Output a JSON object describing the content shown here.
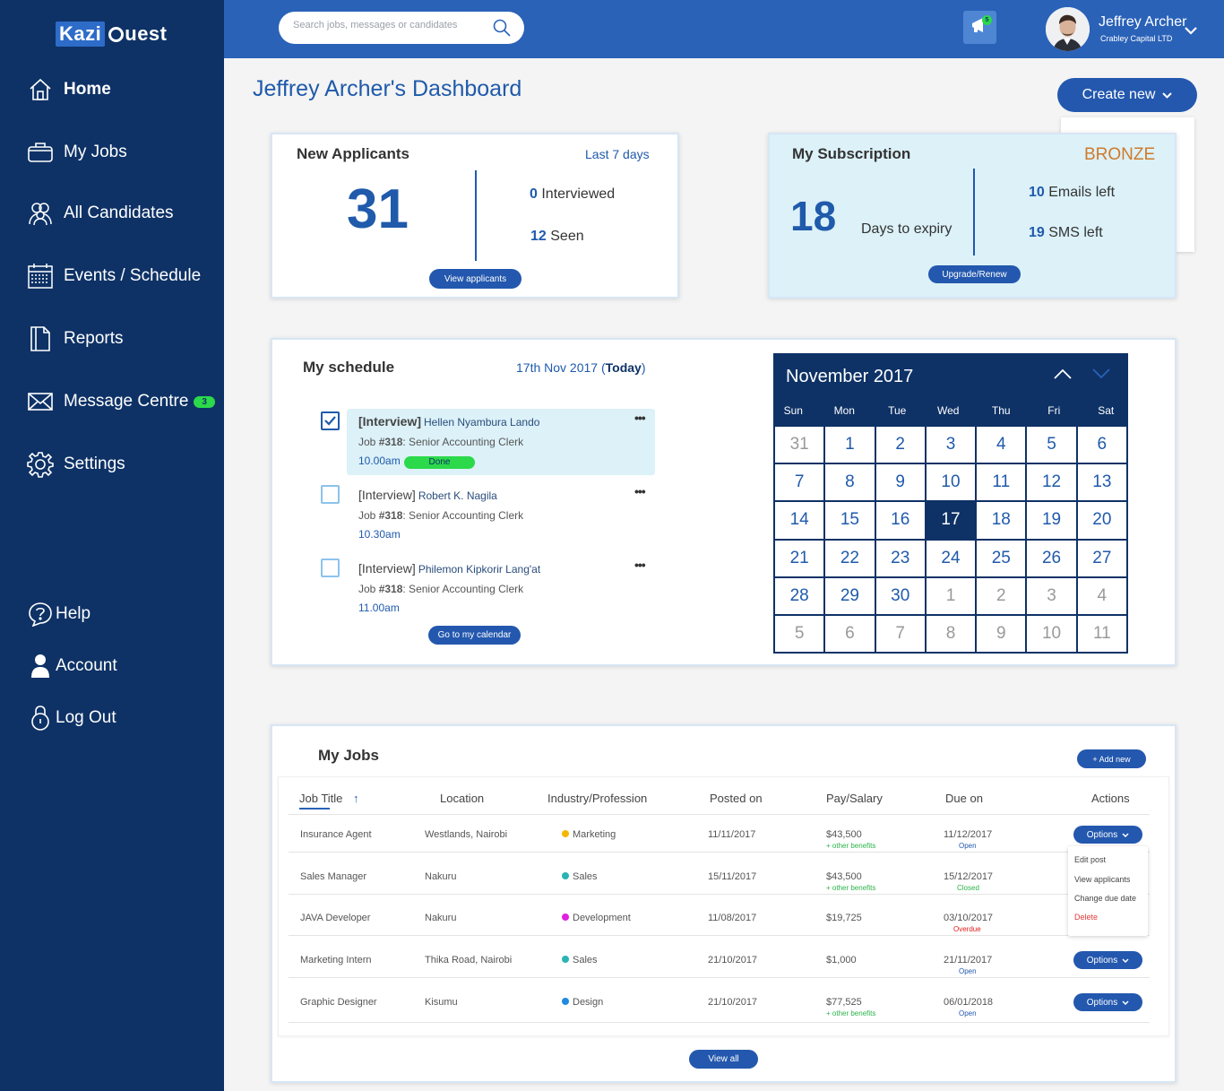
{
  "app": {
    "logo_part1": "Kazi",
    "logo_part2": "uest"
  },
  "sidebar": {
    "items": [
      {
        "label": "Home"
      },
      {
        "label": "My Jobs"
      },
      {
        "label": "All Candidates"
      },
      {
        "label": "Events / Schedule"
      },
      {
        "label": "Reports"
      },
      {
        "label": "Message Centre",
        "badge": "3"
      },
      {
        "label": "Settings"
      }
    ],
    "bottom": [
      {
        "label": "Help"
      },
      {
        "label": "Account"
      },
      {
        "label": "Log Out"
      }
    ]
  },
  "topbar": {
    "search_placeholder": "Search jobs, messages or candidates",
    "notification_count": "5",
    "user_name": "Jeffrey Archer",
    "user_company": "Crabley Capital LTD"
  },
  "page": {
    "title": "Jeffrey Archer's Dashboard",
    "create_label": "Create new"
  },
  "applicants": {
    "title": "New Applicants",
    "period": "Last 7 days",
    "count": "31",
    "interviewed_num": "0",
    "interviewed_label": "Interviewed",
    "seen_num": "12",
    "seen_label": "Seen",
    "button": "View applicants"
  },
  "subscription": {
    "title": "My Subscription",
    "tier": "BRONZE",
    "days": "18",
    "days_label": "Days to expiry",
    "emails_num": "10",
    "emails_label": "Emails left",
    "sms_num": "19",
    "sms_label": "SMS left",
    "button": "Upgrade/Renew"
  },
  "schedule": {
    "title": "My schedule",
    "date": "17th Nov 2017 (",
    "today": "Today",
    "date_close": ")",
    "items": [
      {
        "type": "[Interview]",
        "name": "Hellen Nyambura Lando",
        "job_prefix": "Job ",
        "job_num": "#318",
        "job_title": ": Senior Accounting Clerk",
        "time": "10.00am",
        "status": "Done",
        "checked": true
      },
      {
        "type": "[Interview]",
        "name": "Robert K. Nagila",
        "job_prefix": "Job ",
        "job_num": "#318",
        "job_title": ": Senior Accounting Clerk",
        "time": "10.30am",
        "checked": false
      },
      {
        "type": "[Interview]",
        "name": "Philemon Kipkorir Lang'at",
        "job_prefix": "Job ",
        "job_num": "#318",
        "job_title": ": Senior Accounting Clerk",
        "time": "11.00am",
        "checked": false
      }
    ],
    "button": "Go to my calendar"
  },
  "calendar": {
    "month": "November 2017",
    "weekdays": [
      "Sun",
      "Mon",
      "Tue",
      "Wed",
      "Thu",
      "Fri",
      "Sat"
    ],
    "days": [
      "31",
      "1",
      "2",
      "3",
      "4",
      "5",
      "6",
      "7",
      "8",
      "9",
      "10",
      "11",
      "12",
      "13",
      "14",
      "15",
      "16",
      "17",
      "18",
      "19",
      "20",
      "21",
      "22",
      "23",
      "24",
      "25",
      "26",
      "27",
      "28",
      "29",
      "30",
      "1",
      "2",
      "3",
      "4",
      "5",
      "6",
      "7",
      "8",
      "9",
      "10",
      "11"
    ],
    "current_month_start": 1,
    "current_month_end": 30,
    "today_index": 17
  },
  "jobs": {
    "title": "My Jobs",
    "add_label": "+ Add new",
    "headers": [
      "Job Title",
      "Location",
      "Industry/Profession",
      "Posted on",
      "Pay/Salary",
      "Due on",
      "Actions"
    ],
    "rows": [
      {
        "title": "Insurance Agent",
        "location": "Westlands, Nairobi",
        "industry": "Marketing",
        "industry_color": "#f5b800",
        "posted": "11/11/2017",
        "pay": "$43,500",
        "pay_note": "+ other benefits",
        "due": "11/12/2017",
        "due_status": "Open",
        "due_color": "#2358ae",
        "action": "Options"
      },
      {
        "title": "Sales Manager",
        "location": "Nakuru",
        "industry": "Sales",
        "industry_color": "#2bb3b3",
        "posted": "15/11/2017",
        "pay": "$43,500",
        "pay_note": "+ other benefits",
        "due": "15/12/2017",
        "due_status": "Closed",
        "due_color": "#2bb34a",
        "action": ""
      },
      {
        "title": "JAVA Developer",
        "location": "Nakuru",
        "industry": "Development",
        "industry_color": "#e020e0",
        "posted": "11/08/2017",
        "pay": "$19,725",
        "pay_note": "",
        "due": "03/10/2017",
        "due_status": "Overdue",
        "due_color": "#e02020",
        "action": ""
      },
      {
        "title": "Marketing Intern",
        "location": "Thika Road, Nairobi",
        "industry": "Sales",
        "industry_color": "#2bb3b3",
        "posted": "21/10/2017",
        "pay": "$1,000",
        "pay_note": "",
        "due": "21/11/2017",
        "due_status": "Open",
        "due_color": "#2358ae",
        "action": "Options"
      },
      {
        "title": "Graphic Designer",
        "location": "Kisumu",
        "industry": "Design",
        "industry_color": "#1f8ae0",
        "posted": "21/10/2017",
        "pay": "$77,525",
        "pay_note": "+ other benefits",
        "due": "06/01/2018",
        "due_status": "Open",
        "due_color": "#2358ae",
        "action": "Options"
      }
    ],
    "options_menu": [
      "Edit post",
      "View applicants",
      "Change due date",
      "Delete"
    ],
    "view_all": "View all"
  },
  "colors": {
    "sidebar": "#0e3266",
    "topbar": "#2a62b8",
    "accent": "#2358ae",
    "tier": "#d07a2a",
    "success": "#2bd94a"
  }
}
